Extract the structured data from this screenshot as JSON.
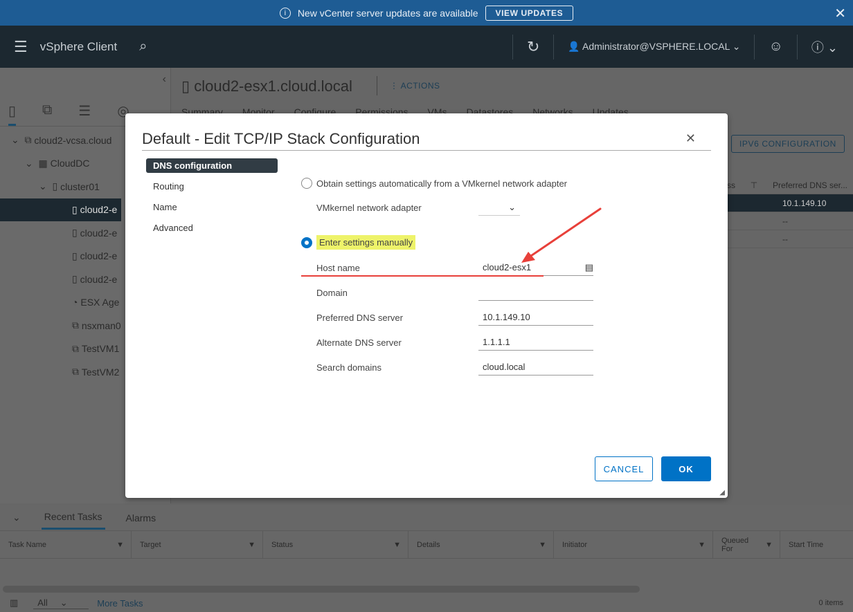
{
  "banner": {
    "message": "New vCenter server updates are available",
    "button": "VIEW UPDATES"
  },
  "header": {
    "app_title": "vSphere Client",
    "user": "Administrator@VSPHERE.LOCAL"
  },
  "tree": [
    "cloud2-vcsa.cloud",
    "CloudDC",
    "cluster01",
    "cloud2-e",
    "cloud2-e",
    "cloud2-e",
    "cloud2-e",
    "ESX Age",
    "nsxman0",
    "TestVM1",
    "TestVM2"
  ],
  "main": {
    "title": "cloud2-esx1.cloud.local",
    "actions": "ACTIONS",
    "tabs": [
      "Summary",
      "Monitor",
      "Configure",
      "Permissions",
      "VMs",
      "Datastores",
      "Networks",
      "Updates"
    ],
    "ipv6": "IPV6 CONFIGURATION",
    "grid": {
      "col_partial": "ss",
      "col_dns": "Preferred DNS ser...",
      "rows": [
        "10.1.149.10",
        "--",
        "--"
      ]
    }
  },
  "modal": {
    "title": "Default - Edit TCP/IP Stack Configuration",
    "nav": [
      "DNS configuration",
      "Routing",
      "Name",
      "Advanced"
    ],
    "opt_auto": "Obtain settings automatically from a VMkernel network adapter",
    "vmk_label": "VMkernel network adapter",
    "opt_manual": "Enter settings manually",
    "fields": [
      {
        "label": "Host name",
        "value": "cloud2-esx1"
      },
      {
        "label": "Domain",
        "value": ""
      },
      {
        "label": "Preferred DNS server",
        "value": "10.1.149.10"
      },
      {
        "label": "Alternate DNS server",
        "value": "1.1.1.1"
      },
      {
        "label": "Search domains",
        "value": "cloud.local"
      }
    ],
    "cancel": "CANCEL",
    "ok": "OK"
  },
  "bottom": {
    "tabs": [
      "Recent Tasks",
      "Alarms"
    ],
    "columns": [
      "Task Name",
      "Target",
      "Status",
      "Details",
      "Initiator",
      "Queued For",
      "Start Time"
    ],
    "filter": "All",
    "more": "More Tasks",
    "count": "0 items"
  },
  "colors": {
    "accent": "#0072c6",
    "highlight": "#eef36a",
    "arrow": "#e8403a"
  }
}
